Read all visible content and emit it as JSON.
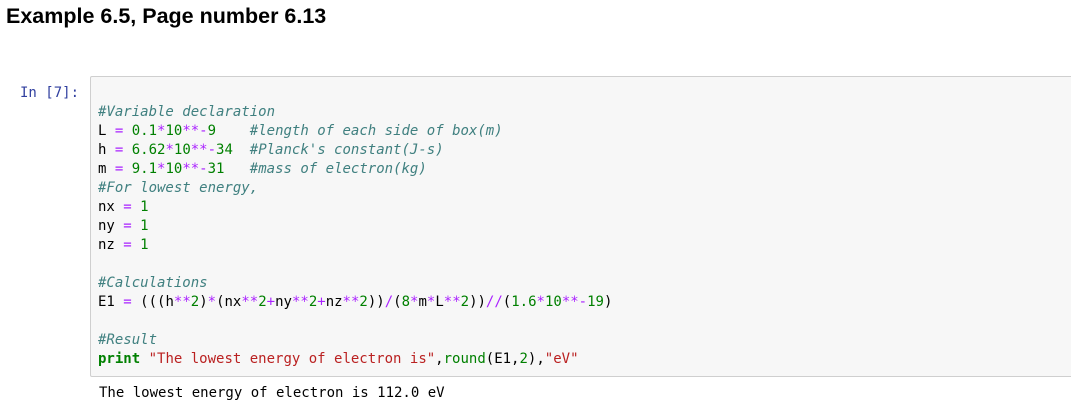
{
  "heading": "Example 6.5, Page number 6.13",
  "cell": {
    "prompt": "In [7]:",
    "code_lines": [
      [
        {
          "t": "cm",
          "v": "#Variable declaration"
        }
      ],
      [
        {
          "t": "va",
          "v": "L "
        },
        {
          "t": "op",
          "v": "="
        },
        {
          "t": "va",
          "v": " "
        },
        {
          "t": "nu",
          "v": "0.1"
        },
        {
          "t": "op",
          "v": "*"
        },
        {
          "t": "nu",
          "v": "10"
        },
        {
          "t": "op",
          "v": "**-"
        },
        {
          "t": "nu",
          "v": "9"
        },
        {
          "t": "va",
          "v": "    "
        },
        {
          "t": "cm",
          "v": "#length of each side of box(m)"
        }
      ],
      [
        {
          "t": "va",
          "v": "h "
        },
        {
          "t": "op",
          "v": "="
        },
        {
          "t": "va",
          "v": " "
        },
        {
          "t": "nu",
          "v": "6.62"
        },
        {
          "t": "op",
          "v": "*"
        },
        {
          "t": "nu",
          "v": "10"
        },
        {
          "t": "op",
          "v": "**-"
        },
        {
          "t": "nu",
          "v": "34"
        },
        {
          "t": "va",
          "v": "  "
        },
        {
          "t": "cm",
          "v": "#Planck's constant(J-s)"
        }
      ],
      [
        {
          "t": "va",
          "v": "m "
        },
        {
          "t": "op",
          "v": "="
        },
        {
          "t": "va",
          "v": " "
        },
        {
          "t": "nu",
          "v": "9.1"
        },
        {
          "t": "op",
          "v": "*"
        },
        {
          "t": "nu",
          "v": "10"
        },
        {
          "t": "op",
          "v": "**-"
        },
        {
          "t": "nu",
          "v": "31"
        },
        {
          "t": "va",
          "v": "   "
        },
        {
          "t": "cm",
          "v": "#mass of electron(kg)"
        }
      ],
      [
        {
          "t": "cm",
          "v": "#For lowest energy,"
        }
      ],
      [
        {
          "t": "va",
          "v": "nx "
        },
        {
          "t": "op",
          "v": "="
        },
        {
          "t": "va",
          "v": " "
        },
        {
          "t": "nu",
          "v": "1"
        }
      ],
      [
        {
          "t": "va",
          "v": "ny "
        },
        {
          "t": "op",
          "v": "="
        },
        {
          "t": "va",
          "v": " "
        },
        {
          "t": "nu",
          "v": "1"
        }
      ],
      [
        {
          "t": "va",
          "v": "nz "
        },
        {
          "t": "op",
          "v": "="
        },
        {
          "t": "va",
          "v": " "
        },
        {
          "t": "nu",
          "v": "1"
        }
      ],
      [],
      [
        {
          "t": "cm",
          "v": "#Calculations"
        }
      ],
      [
        {
          "t": "va",
          "v": "E1 "
        },
        {
          "t": "op",
          "v": "="
        },
        {
          "t": "va",
          "v": " (((h"
        },
        {
          "t": "op",
          "v": "**"
        },
        {
          "t": "nu",
          "v": "2"
        },
        {
          "t": "va",
          "v": ")"
        },
        {
          "t": "op",
          "v": "*"
        },
        {
          "t": "va",
          "v": "(nx"
        },
        {
          "t": "op",
          "v": "**"
        },
        {
          "t": "nu",
          "v": "2"
        },
        {
          "t": "op",
          "v": "+"
        },
        {
          "t": "va",
          "v": "ny"
        },
        {
          "t": "op",
          "v": "**"
        },
        {
          "t": "nu",
          "v": "2"
        },
        {
          "t": "op",
          "v": "+"
        },
        {
          "t": "va",
          "v": "nz"
        },
        {
          "t": "op",
          "v": "**"
        },
        {
          "t": "nu",
          "v": "2"
        },
        {
          "t": "va",
          "v": "))"
        },
        {
          "t": "op",
          "v": "/"
        },
        {
          "t": "va",
          "v": "("
        },
        {
          "t": "nu",
          "v": "8"
        },
        {
          "t": "op",
          "v": "*"
        },
        {
          "t": "va",
          "v": "m"
        },
        {
          "t": "op",
          "v": "*"
        },
        {
          "t": "va",
          "v": "L"
        },
        {
          "t": "op",
          "v": "**"
        },
        {
          "t": "nu",
          "v": "2"
        },
        {
          "t": "va",
          "v": "))"
        },
        {
          "t": "op",
          "v": "//"
        },
        {
          "t": "va",
          "v": "("
        },
        {
          "t": "nu",
          "v": "1.6"
        },
        {
          "t": "op",
          "v": "*"
        },
        {
          "t": "nu",
          "v": "10"
        },
        {
          "t": "op",
          "v": "**-"
        },
        {
          "t": "nu",
          "v": "19"
        },
        {
          "t": "va",
          "v": ")"
        }
      ],
      [],
      [
        {
          "t": "cm",
          "v": "#Result"
        }
      ],
      [
        {
          "t": "kw",
          "v": "print"
        },
        {
          "t": "va",
          "v": " "
        },
        {
          "t": "st",
          "v": "\"The lowest energy of electron is\""
        },
        {
          "t": "va",
          "v": ","
        },
        {
          "t": "bi",
          "v": "round"
        },
        {
          "t": "va",
          "v": "(E1,"
        },
        {
          "t": "nu",
          "v": "2"
        },
        {
          "t": "va",
          "v": "),"
        },
        {
          "t": "st",
          "v": "\"eV\""
        }
      ]
    ],
    "output": "The lowest energy of electron is 112.0 eV"
  },
  "colors": {
    "prompt": "#303f9f",
    "comment": "#408080",
    "number": "#008000",
    "operator": "#aa22ff",
    "keyword": "#008000",
    "string": "#ba2121",
    "input_background": "#f7f7f7",
    "input_border": "#cfcfcf"
  }
}
